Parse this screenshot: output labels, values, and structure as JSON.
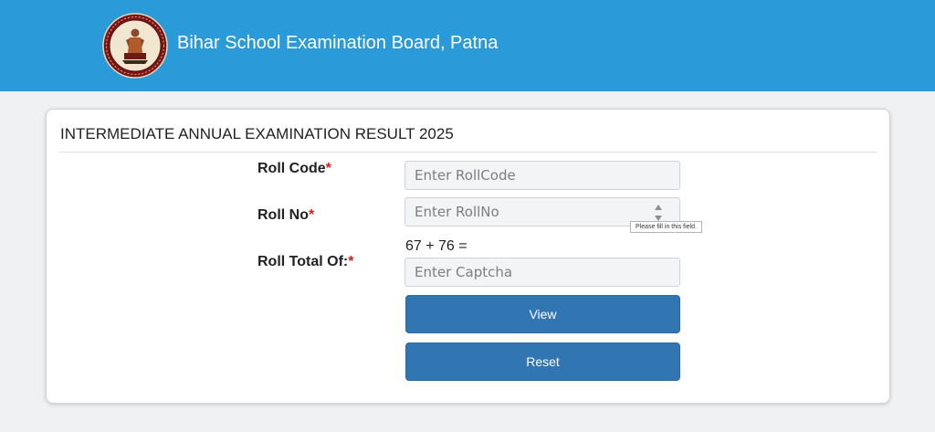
{
  "header": {
    "title": "Bihar School Examination Board, Patna",
    "logo_icon": "bseb-emblem-icon",
    "bg_color": "#2a9bd8"
  },
  "form": {
    "title": "INTERMEDIATE ANNUAL EXAMINATION RESULT 2025",
    "roll_code": {
      "label": "Roll Code",
      "required_mark": "*",
      "placeholder": "Enter RollCode",
      "value": ""
    },
    "roll_no": {
      "label": "Roll No",
      "required_mark": "*",
      "placeholder": "Enter RollNo",
      "value": "",
      "validation_tooltip": "Please fill in this field."
    },
    "captcha": {
      "label": "Roll Total Of:",
      "required_mark": "*",
      "question": "67 + 76 =",
      "placeholder": "Enter Captcha",
      "value": ""
    },
    "view_label": "View",
    "reset_label": "Reset",
    "button_color": "#3275b3",
    "required_color": "#e01b1b"
  }
}
